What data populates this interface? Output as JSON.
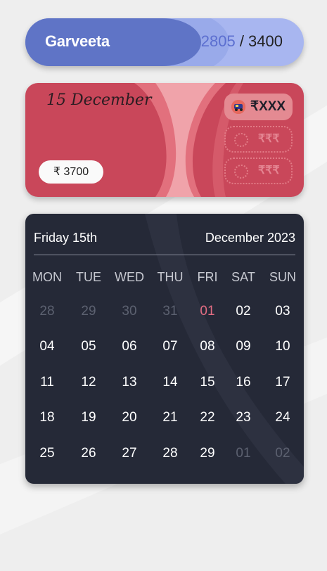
{
  "header": {
    "name": "Garveeta",
    "used": "2805",
    "separator": " / ",
    "total": "3400"
  },
  "card": {
    "date": "15 December",
    "amount": "₹ 3700",
    "chips": [
      {
        "label": "₹XXX",
        "icon": "auto-rickshaw-icon",
        "state": "active"
      },
      {
        "label": "₹₹₹",
        "icon": "empty-slot-icon",
        "state": "placeholder"
      },
      {
        "label": "₹₹₹",
        "icon": "empty-slot-icon",
        "state": "placeholder"
      }
    ]
  },
  "calendar": {
    "selected_day": "Friday 15th",
    "month_year": "December 2023",
    "weekdays": [
      "MON",
      "TUE",
      "WED",
      "THU",
      "FRI",
      "SAT",
      "SUN"
    ],
    "weeks": [
      [
        "28",
        "29",
        "30",
        "31",
        "01",
        "02",
        "03"
      ],
      [
        "04",
        "05",
        "06",
        "07",
        "08",
        "09",
        "10"
      ],
      [
        "11",
        "12",
        "13",
        "14",
        "15",
        "16",
        "17"
      ],
      [
        "18",
        "19",
        "20",
        "21",
        "22",
        "23",
        "24"
      ],
      [
        "25",
        "26",
        "27",
        "28",
        "29",
        "01",
        "02"
      ]
    ],
    "muted_cells": [
      "0-0",
      "0-1",
      "0-2",
      "0-3",
      "4-5",
      "4-6"
    ],
    "highlight_cell": "0-4"
  },
  "colors": {
    "header_dark": "#5f74c6",
    "header_light": "#a8b6f0",
    "card_red": "#c9475a",
    "calendar_bg": "#252937",
    "highlight": "#e36d83"
  }
}
